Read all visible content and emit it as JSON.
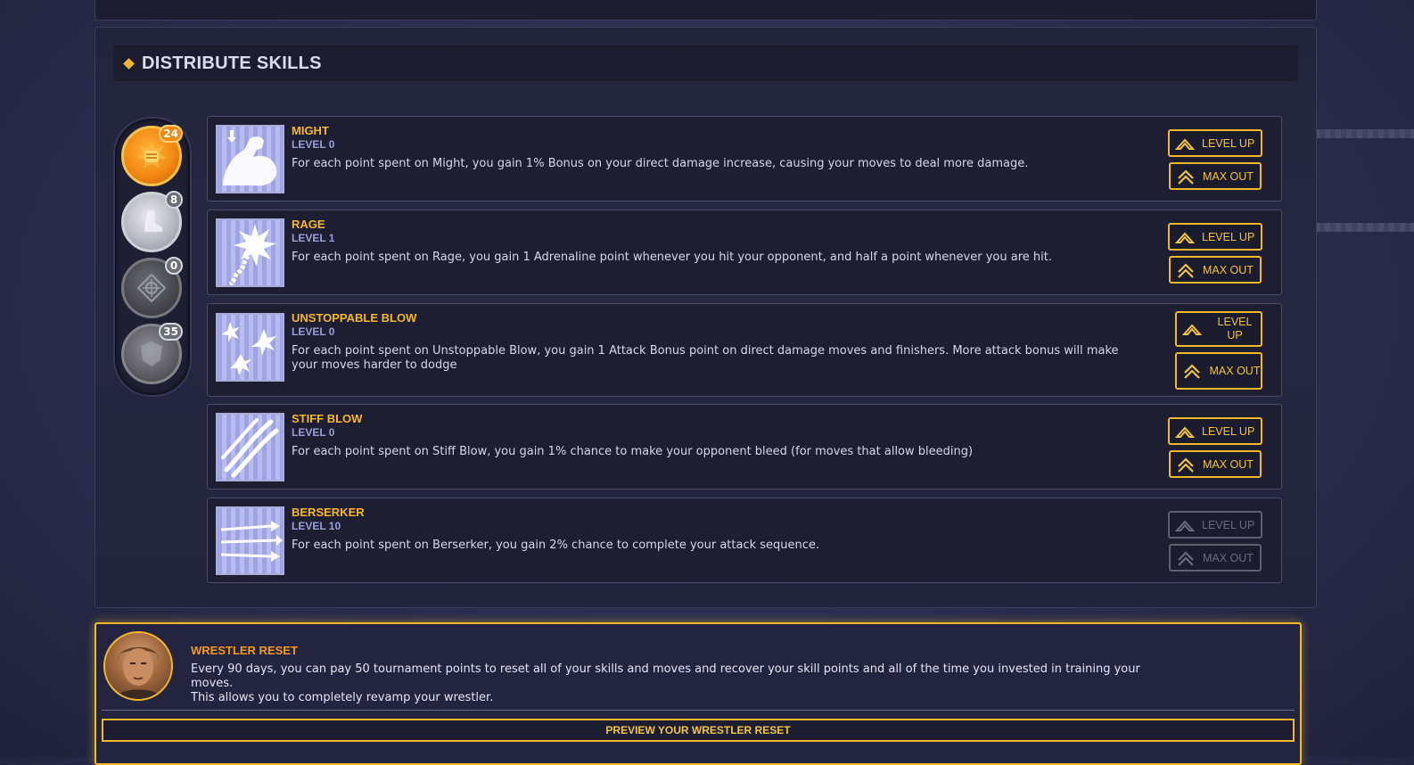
{
  "section": {
    "title": "DISTRIBUTE SKILLS"
  },
  "badges": [
    {
      "name": "gold-fist-badge",
      "count": "24"
    },
    {
      "name": "silver-boot-badge",
      "count": "8"
    },
    {
      "name": "dark-target-badge",
      "count": "0"
    },
    {
      "name": "grey-shield-badge",
      "count": "35"
    }
  ],
  "skills": [
    {
      "name": "MIGHT",
      "level": "LEVEL 0",
      "icon": "flexed-arm-icon",
      "description": "For each point spent on Might, you gain 1% Bonus on your direct damage increase, causing your moves to deal more damage.",
      "level_up": "LEVEL UP",
      "max_out": "MAX OUT",
      "enabled": true
    },
    {
      "name": "RAGE",
      "level": "LEVEL 1",
      "icon": "burst-rope-icon",
      "description": "For each point spent on Rage, you gain 1 Adrenaline point whenever you hit your opponent, and half a point whenever you are hit.",
      "level_up": "LEVEL UP",
      "max_out": "MAX OUT",
      "enabled": true
    },
    {
      "name": "UNSTOPPABLE BLOW",
      "level": "LEVEL 0",
      "icon": "impact-stars-icon",
      "description": "For each point spent on Unstoppable Blow, you gain 1 Attack Bonus point on direct damage moves and finishers. More attack bonus will make your moves harder to dodge",
      "level_up": "LEVEL UP",
      "max_out": "MAX OUT",
      "enabled": true
    },
    {
      "name": "STIFF BLOW",
      "level": "LEVEL 0",
      "icon": "claw-slash-icon",
      "description": "For each point spent on Stiff Blow, you gain 1% chance to make your opponent bleed (for moves that allow bleeding)",
      "level_up": "LEVEL UP",
      "max_out": "MAX OUT",
      "enabled": true
    },
    {
      "name": "BERSERKER",
      "level": "LEVEL 10",
      "icon": "arrow-volley-icon",
      "description": "For each point spent on Berserker, you gain 2% chance to complete your attack sequence.",
      "level_up": "LEVEL UP",
      "max_out": "MAX OUT",
      "enabled": false
    }
  ],
  "reset": {
    "title": "WRESTLER RESET",
    "line1": "Every 90 days, you can pay 50 tournament points to reset all of your skills and moves and recover your skill points and all of the time you invested in training your moves.",
    "line2": "This allows you to completely revamp your wrestler.",
    "button": "PREVIEW YOUR WRESTLER RESET"
  },
  "colors": {
    "accent": "#f1b82a",
    "panel": "#22243a",
    "level_text": "#9aa0d6"
  }
}
